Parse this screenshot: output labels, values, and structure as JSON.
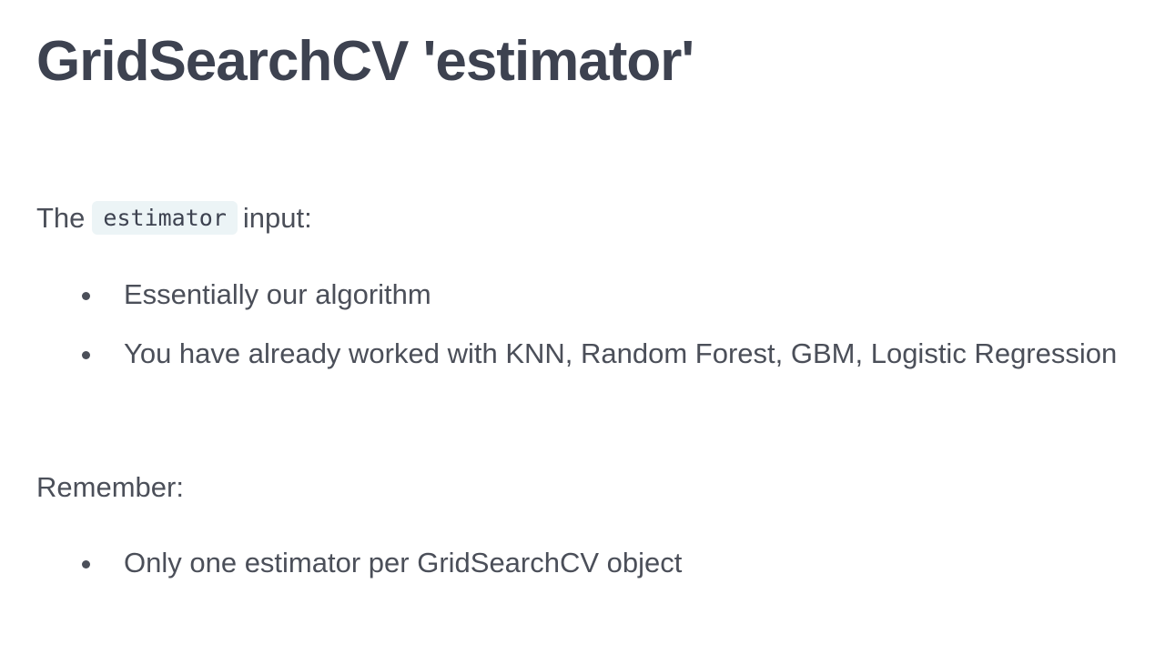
{
  "slide": {
    "title": "GridSearchCV 'estimator'",
    "intro": {
      "before": "The",
      "code": "estimator",
      "after": "input:"
    },
    "intro_bullets": [
      "Essentially our algorithm",
      "You have already worked with KNN, Random Forest, GBM, Logistic Regression"
    ],
    "remember_label": "Remember:",
    "remember_bullets": [
      "Only one estimator per GridSearchCV object"
    ]
  },
  "colors": {
    "title": "#3d4250",
    "text": "#4b4f59",
    "code_background": "#ecf4f6"
  }
}
